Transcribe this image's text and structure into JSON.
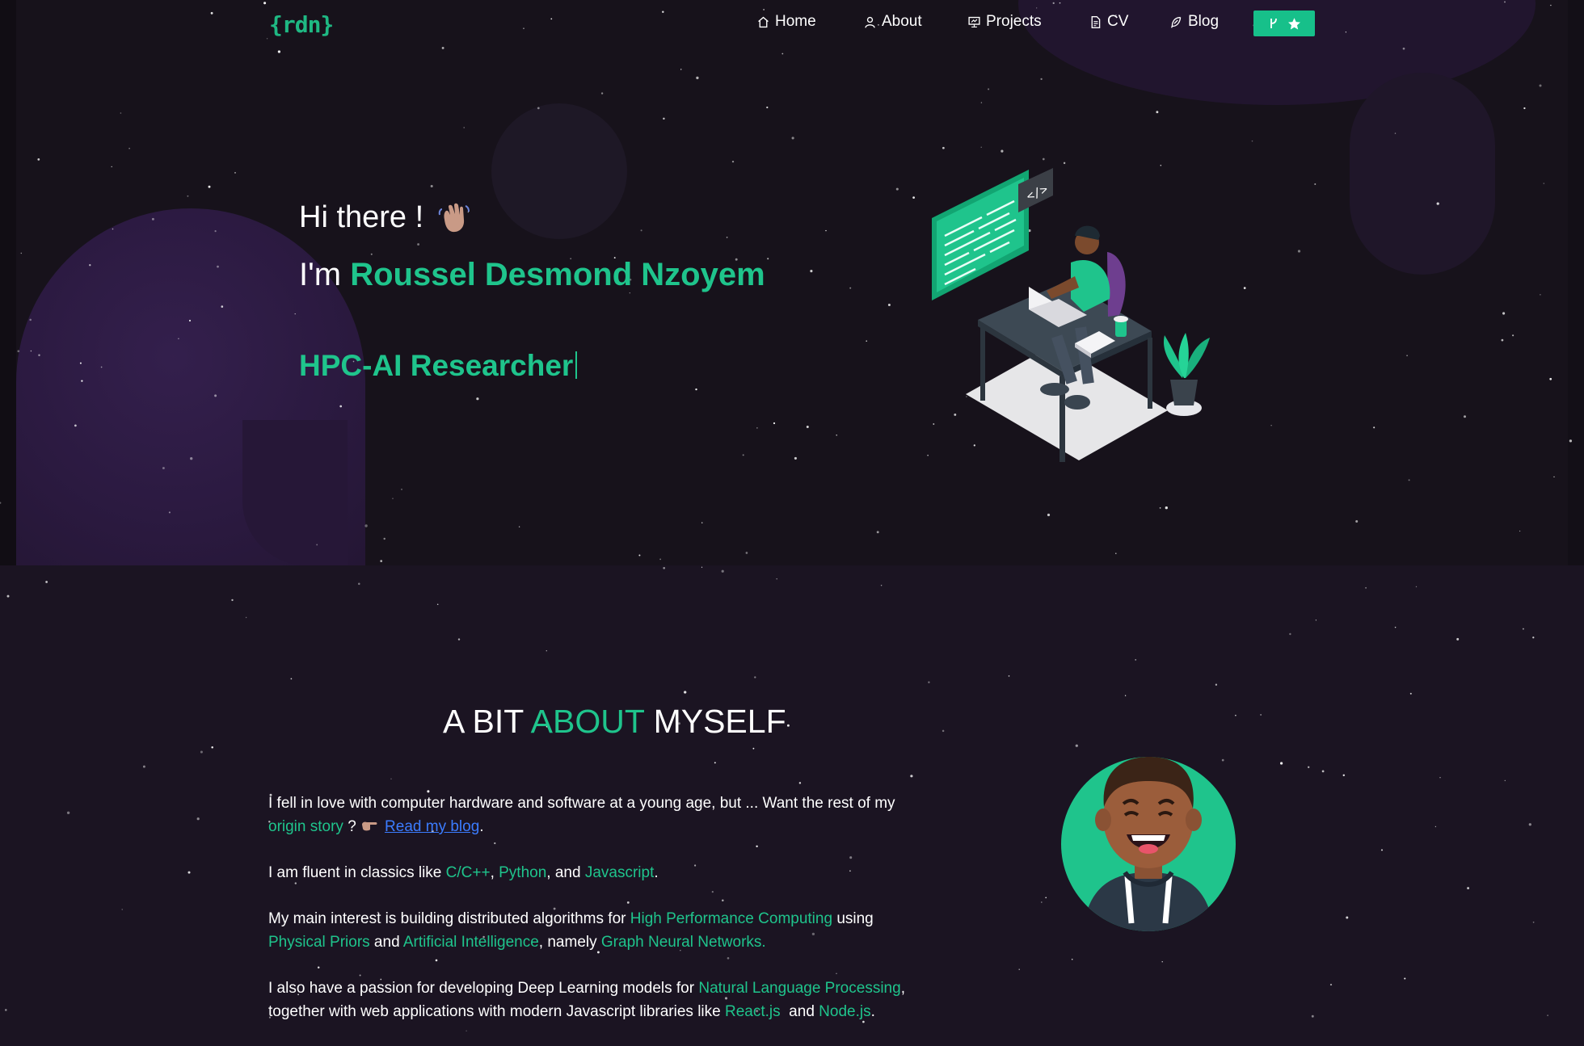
{
  "nav": {
    "logo": "{rdn}",
    "items": [
      {
        "label": "Home",
        "icon": "home-icon"
      },
      {
        "label": "About",
        "icon": "user-icon"
      },
      {
        "label": "Projects",
        "icon": "presentation-icon"
      },
      {
        "label": "CV",
        "icon": "document-icon"
      },
      {
        "label": "Blog",
        "icon": "feather-icon"
      }
    ],
    "github_button": {
      "icons": [
        "git-fork-icon",
        "star-icon"
      ],
      "color": "#17c08a"
    }
  },
  "hero": {
    "greeting": "Hi there !",
    "greeting_emoji": "waving-hand",
    "name_prefix": "I'm",
    "name": "Roussel Desmond Nzoyem",
    "role": "HPC-AI Researcher"
  },
  "about": {
    "title_part1": "A BIT",
    "title_accent": "ABOUT",
    "title_part2": "MYSELF",
    "p1": {
      "text1": "I fell in love with computer hardware and software at a young age, but ... Want the rest of my",
      "hl1": "origin story",
      "text2": " ? ",
      "link": "Read my blog",
      "text3": "."
    },
    "p2": {
      "text1": "I am fluent in classics like ",
      "hl1": "C/C++",
      "sep1": ", ",
      "hl2": "Python",
      "sep2": ", and ",
      "hl3": "Javascript",
      "end": "."
    },
    "p3": {
      "text1": "My main interest is building distributed algorithms for ",
      "hl1": "High Performance Computing",
      "text2": " using ",
      "hl2": "Physical Priors",
      "text3": " and ",
      "hl3": "Artificial Intelligence",
      "text4": ", namely ",
      "hl4": "Graph Neural Networks."
    },
    "p4": {
      "text1": "I also have a passion for developing Deep Learning models for ",
      "hl1": "Natural Language Processing",
      "text2": ", together with web applications with modern Javascript libraries like ",
      "hl2": "React.js",
      "text3": "  and ",
      "hl3": "Node.js",
      "end": "."
    }
  },
  "colors": {
    "accent": "#1fc48c",
    "background": "#1b1422",
    "hero_background": "#17121b",
    "link": "#3b7cff"
  }
}
